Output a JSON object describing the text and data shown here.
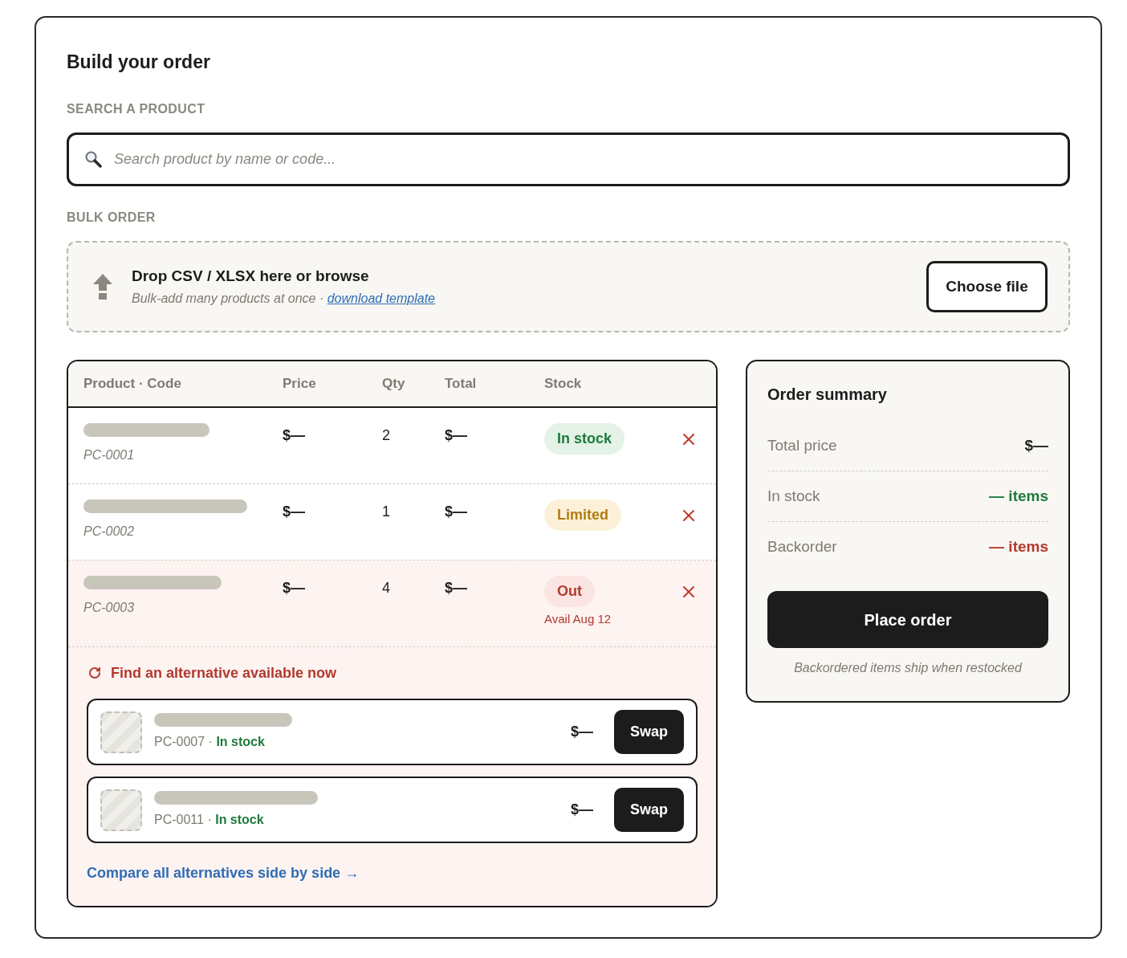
{
  "title": "Build your order",
  "search": {
    "label": "SEARCH A PRODUCT",
    "placeholder": "Search product by name or code..."
  },
  "bulk_order": {
    "label": "BULK ORDER",
    "title": "Drop CSV / XLSX here or browse",
    "hint": "Bulk-add many products at once ·",
    "link": "download template",
    "button": "Choose file"
  },
  "table": {
    "columns": [
      "Product · Code",
      "Price",
      "Qty",
      "Total",
      "Stock"
    ],
    "rows": [
      {
        "code": "PC-0001",
        "price": "$—",
        "qty": "2",
        "total": "$—",
        "stock": {
          "kind": "in_stock",
          "label": "In stock"
        }
      },
      {
        "code": "PC-0002",
        "price": "$—",
        "qty": "1",
        "total": "$—",
        "stock": {
          "kind": "limited",
          "label": "Limited"
        }
      },
      {
        "code": "PC-0003",
        "price": "$—",
        "qty": "4",
        "total": "$—",
        "stock": {
          "kind": "out",
          "label": "Out",
          "note": "Avail Aug 12"
        }
      }
    ],
    "alternatives": {
      "title": "Find an alternative available now",
      "items": [
        {
          "meta": "PC-0007 · **In stock**",
          "price": "$—",
          "button": "Swap"
        },
        {
          "meta": "PC-0011 · **In stock**",
          "price": "$—",
          "button": "Swap"
        }
      ],
      "link": "Compare all alternatives side by side →"
    }
  },
  "summary": {
    "title": "Order summary",
    "rows": [
      {
        "kind": "total",
        "label": "Total price",
        "value": "$—"
      },
      {
        "kind": "in_stock",
        "label": "In stock",
        "value": "— items"
      },
      {
        "kind": "backorder",
        "label": "Backorder",
        "value": "— items"
      }
    ],
    "button": "Place order",
    "note": "Backordered items ship when restocked"
  }
}
